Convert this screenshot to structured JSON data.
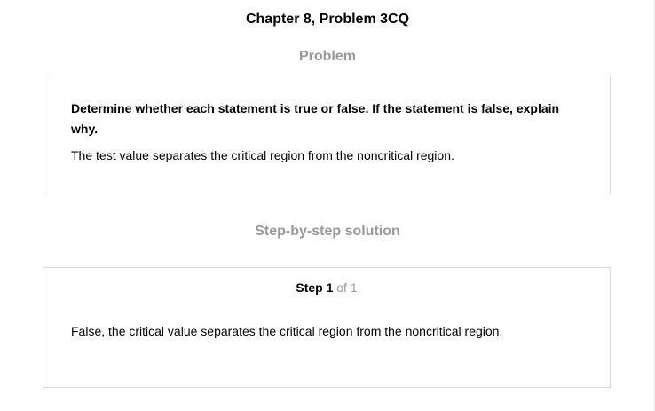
{
  "page": {
    "title": "Chapter 8, Problem 3CQ"
  },
  "problem": {
    "heading": "Problem",
    "question": "Determine whether each statement is true or false. If the statement is false, explain why.",
    "statement": "The test value separates the critical region from the noncritical region."
  },
  "solution": {
    "heading": "Step-by-step solution",
    "step_label": "Step 1",
    "step_of": "of 1",
    "text": "False, the critical value separates the critical region from the noncritical region."
  }
}
